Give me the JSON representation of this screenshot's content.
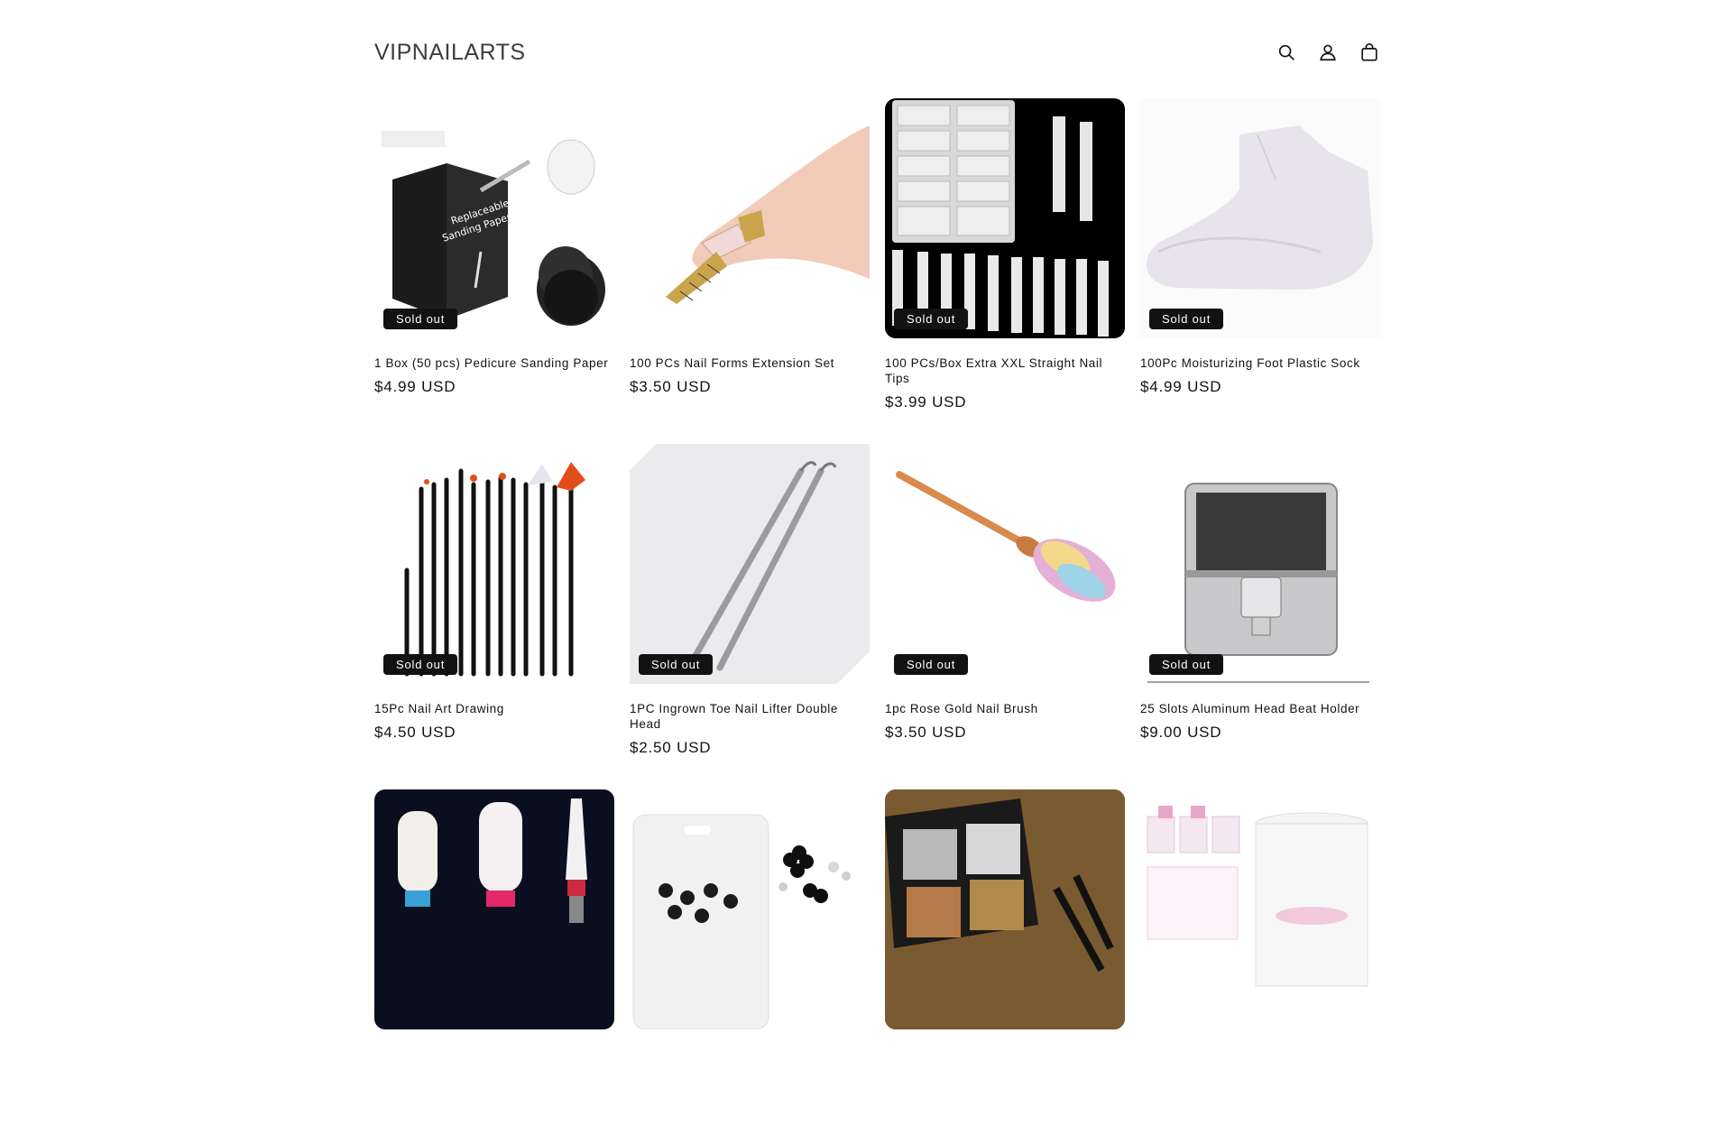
{
  "store": {
    "name": "VIPNAILARTS"
  },
  "header": {
    "icons": [
      "search-icon",
      "account-icon",
      "cart-icon"
    ]
  },
  "products": [
    {
      "title": "1 Box (50 pcs) Pedicure Sanding Paper",
      "price": "$4.99 USD",
      "badge": "Sold out",
      "image": "sanding-paper"
    },
    {
      "title": "100 PCs Nail Forms Extension Set",
      "price": "$3.50 USD",
      "badge": "",
      "image": "nail-forms"
    },
    {
      "title": "100 PCs/Box Extra XXL Straight Nail Tips",
      "price": "$3.99 USD",
      "badge": "Sold out",
      "image": "nail-tips"
    },
    {
      "title": "100Pc Moisturizing Foot Plastic Sock",
      "price": "$4.99 USD",
      "badge": "Sold out",
      "image": "foot-sock"
    },
    {
      "title": "15Pc Nail Art Drawing",
      "price": "$4.50 USD",
      "badge": "Sold out",
      "image": "brush-set"
    },
    {
      "title": "1PC Ingrown Toe Nail Lifter Double Head",
      "price": "$2.50 USD",
      "badge": "Sold out",
      "image": "nail-lifter"
    },
    {
      "title": "1pc Rose Gold Nail Brush",
      "price": "$3.50 USD",
      "badge": "Sold out",
      "image": "rose-brush"
    },
    {
      "title": "25 Slots Aluminum Head Beat Holder",
      "price": "$9.00 USD",
      "badge": "Sold out",
      "image": "aluminum-case"
    },
    {
      "title": "",
      "price": "",
      "badge": "",
      "image": "drill-bits"
    },
    {
      "title": "",
      "price": "",
      "badge": "",
      "image": "black-flowers"
    },
    {
      "title": "",
      "price": "",
      "badge": "",
      "image": "eyeshadow-palette"
    },
    {
      "title": "",
      "price": "",
      "badge": "",
      "image": "acrylic-jars"
    }
  ]
}
